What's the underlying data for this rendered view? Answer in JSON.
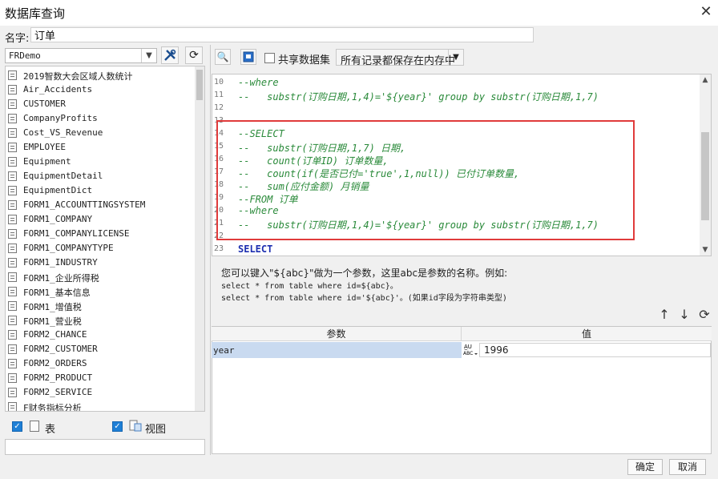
{
  "window": {
    "title": "数据库查询",
    "close_glyph": "✕"
  },
  "name_field": {
    "label": "名字:",
    "value": "订单"
  },
  "datasource": {
    "selected": "FRDemo"
  },
  "tables": [
    "2019智数大会区域人数统计",
    "Air_Accidents",
    "CUSTOMER",
    "CompanyProfits",
    "Cost_VS_Revenue",
    "EMPLOYEE",
    "Equipment",
    "EquipmentDetail",
    "EquipmentDict",
    "FORM1_ACCOUNTTINGSYSTEM",
    "FORM1_COMPANY",
    "FORM1_COMPANYLICENSE",
    "FORM1_COMPANYTYPE",
    "FORM1_INDUSTRY",
    "FORM1_企业所得税",
    "FORM1_基本信息",
    "FORM1_增值税",
    "FORM1_营业税",
    "FORM2_CHANCE",
    "FORM2_CUSTOMER",
    "FORM2_ORDERS",
    "FORM2_PRODUCT",
    "FORM2_SERVICE",
    "F财务指标分析"
  ],
  "filters": {
    "table_label": "表",
    "view_label": "视图"
  },
  "toolbar": {
    "share_label": "共享数据集",
    "save_mode": "所有记录都保存在内存中"
  },
  "editor": {
    "lines": [
      {
        "n": "10",
        "text": "--where"
      },
      {
        "n": "11",
        "text": "--   substr(订购日期,1,4)='${year}' group by substr(订购日期,1,7)"
      },
      {
        "n": "12",
        "text": ""
      },
      {
        "n": "13",
        "text": ""
      },
      {
        "n": "14",
        "text": "--SELECT"
      },
      {
        "n": "15",
        "text": "--   substr(订购日期,1,7) 日期,"
      },
      {
        "n": "16",
        "text": "--   count(订单ID) 订单数量,"
      },
      {
        "n": "17",
        "text": "--   count(if(是否已付='true',1,null)) 已付订单数量,"
      },
      {
        "n": "18",
        "text": "--   sum(应付金额) 月销量"
      },
      {
        "n": "19",
        "text": "--FROM 订单"
      },
      {
        "n": "20",
        "text": "--where"
      },
      {
        "n": "21",
        "text": "--   substr(订购日期,1,4)='${year}' group by substr(订购日期,1,7)"
      },
      {
        "n": "22",
        "text": ""
      },
      {
        "n": "23",
        "text": "SELECT"
      }
    ]
  },
  "hint": {
    "line1": "您可以键入\"${abc}\"做为一个参数，这里abc是参数的名称。例如:",
    "line2": "select * from table where id=${abc}。",
    "line3": "select * from table where id='${abc}'。(如果id字段为字符串类型)"
  },
  "params": {
    "header_param": "参数",
    "header_value": "值",
    "rows": [
      {
        "name": "year",
        "type_icon": "A̲U ABC",
        "value": "1996"
      }
    ]
  },
  "footer": {
    "ok": "确定",
    "cancel": "取消"
  }
}
